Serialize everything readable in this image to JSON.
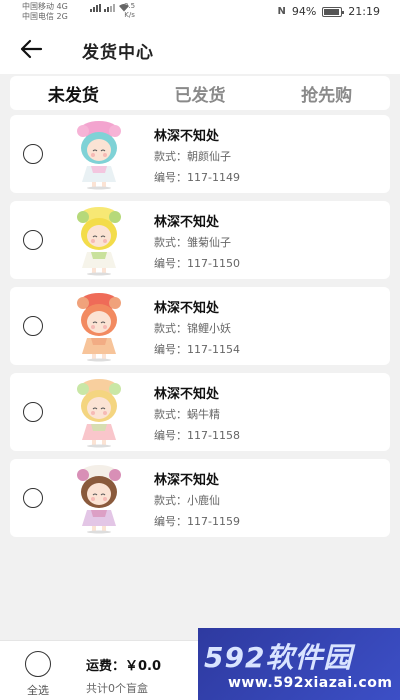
{
  "status_bar": {
    "carrier1": "中国移动",
    "carrier1_net": "4G",
    "carrier2": "中国电信",
    "carrier2_net": "2G",
    "speed_value": "3.5",
    "speed_unit": "K/s",
    "battery_percent": "94%",
    "battery_level": 0.94,
    "time": "21:19",
    "nfc": "N"
  },
  "header": {
    "title": "发货中心",
    "back_icon": "arrow-left-icon"
  },
  "tabs": [
    {
      "label": "未发货",
      "active": true
    },
    {
      "label": "已发货",
      "active": false
    },
    {
      "label": "抢先购",
      "active": false
    }
  ],
  "orders": [
    {
      "shop": "林深不知处",
      "style": "款式：朝颜仙子",
      "code": "编号：117-1149",
      "colors": {
        "hair": "#7fd2d6",
        "hat": "#f3a4cf",
        "dress": "#e9f1f4",
        "accent": "#f6b3d6"
      }
    },
    {
      "shop": "林深不知处",
      "style": "款式：雏菊仙子",
      "code": "编号：117-1150",
      "colors": {
        "hair": "#f3dc4a",
        "hat": "#f7e874",
        "dress": "#f6f4ea",
        "accent": "#b6d97a"
      }
    },
    {
      "shop": "林深不知处",
      "style": "款式：锦鲤小妖",
      "code": "编号：117-1154",
      "colors": {
        "hair": "#f28a60",
        "hat": "#ef6b58",
        "dress": "#f7c49a",
        "accent": "#f0a27b"
      }
    },
    {
      "shop": "林深不知处",
      "style": "款式：蜗牛精",
      "code": "编号：117-1158",
      "colors": {
        "hair": "#f4d580",
        "hat": "#f8cf9e",
        "dress": "#f9c6cb",
        "accent": "#c9e7a6"
      }
    },
    {
      "shop": "林深不知处",
      "style": "款式：小鹿仙",
      "code": "编号：117-1159",
      "colors": {
        "hair": "#8a5a3c",
        "hat": "#f4efe8",
        "dress": "#e3c6e6",
        "accent": "#d88fb6"
      }
    }
  ],
  "footer": {
    "select_all": "全选",
    "shipping": "运费：￥0.0",
    "count": "共计0个盲盒"
  },
  "watermark": {
    "main": "592软件园",
    "url": "www.592xiazai.com"
  }
}
